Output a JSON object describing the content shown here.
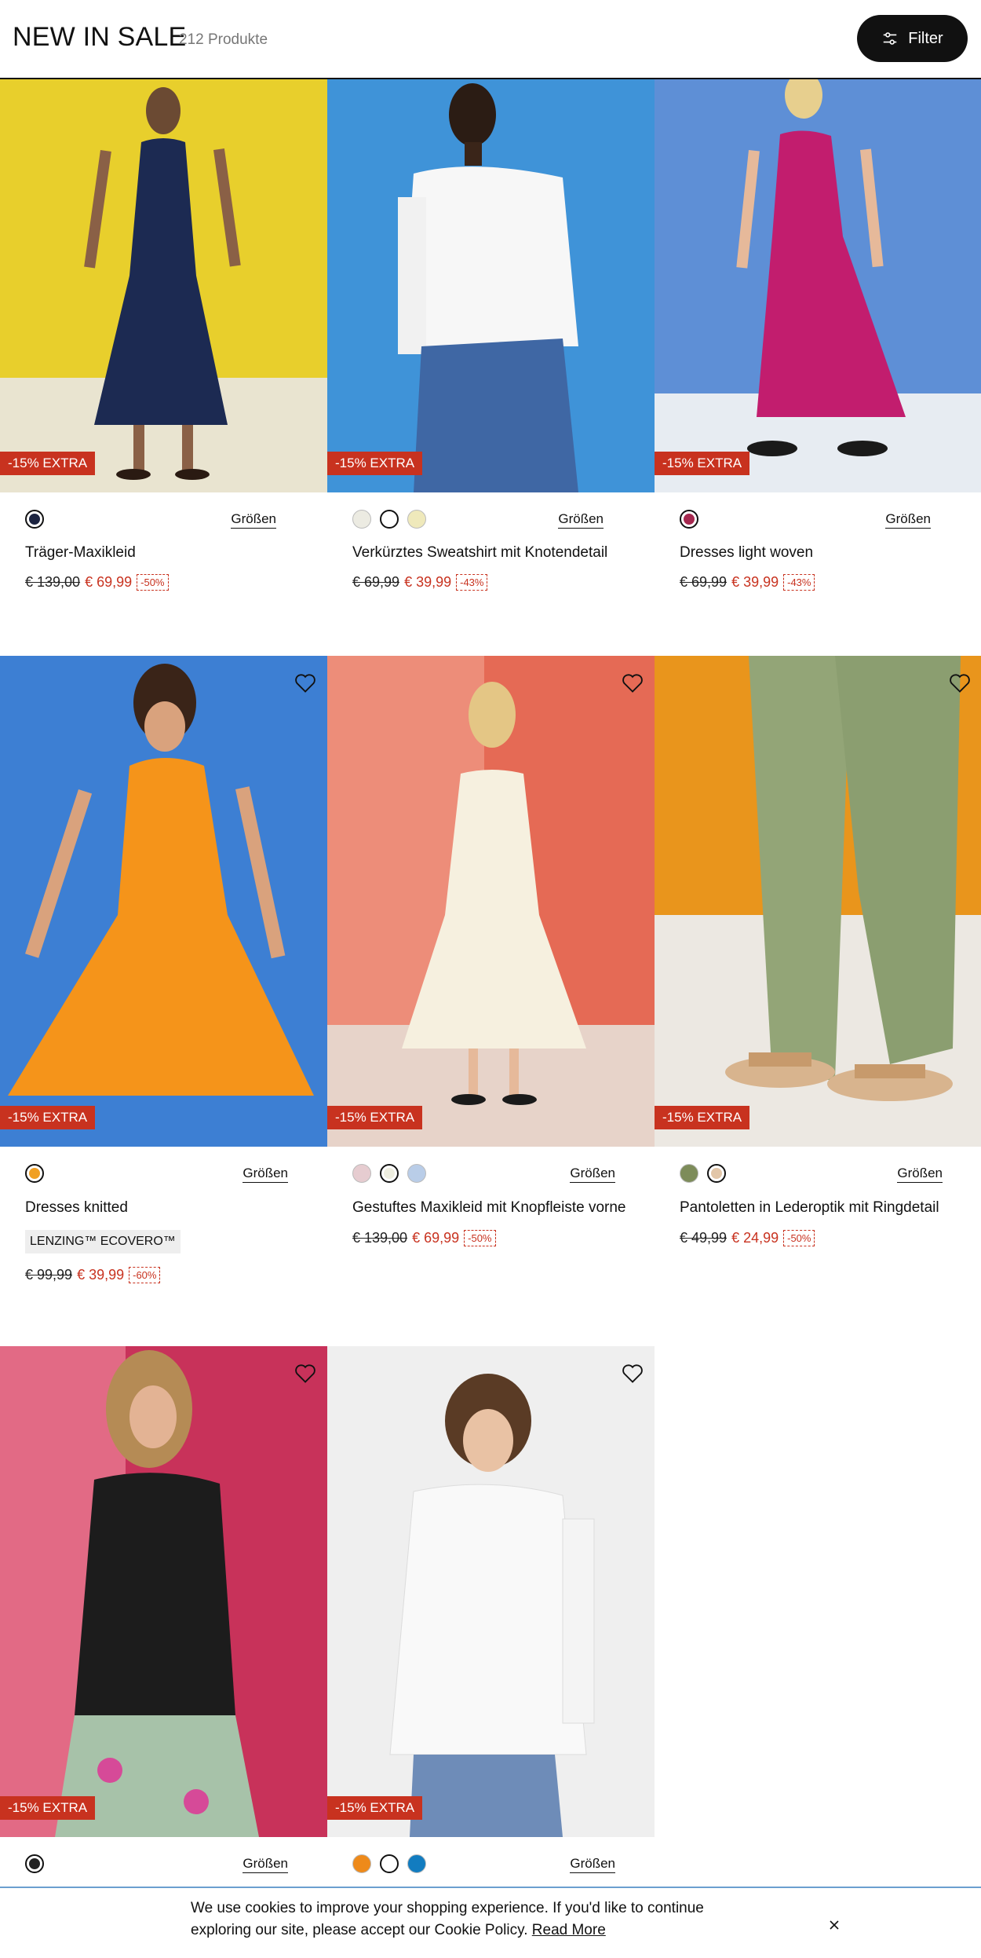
{
  "header": {
    "title": "NEW IN SALE",
    "count": "212 Produkte",
    "filter_label": "Filter"
  },
  "colors": {
    "sale_red": "#c8321f",
    "accent_dark": "#111111"
  },
  "products": [
    {
      "badge": "-15% EXTRA",
      "sizes_label": "Größen",
      "name": "Träger-Maxikleid",
      "old_price": "€ 139,00",
      "new_price": "€ 69,99",
      "discount": "-50%",
      "swatches": [
        "#1b2340"
      ],
      "selected": 0,
      "heart": false
    },
    {
      "badge": "-15% EXTRA",
      "sizes_label": "Größen",
      "name": "Verkürztes Sweatshirt mit Knotendetail",
      "old_price": "€ 69,99",
      "new_price": "€ 39,99",
      "discount": "-43%",
      "swatches": [
        "#ecebe2",
        "#ffffff",
        "#efe9bb"
      ],
      "selected": 1,
      "heart": false
    },
    {
      "badge": "-15% EXTRA",
      "sizes_label": "Größen",
      "name": "Dresses light woven",
      "old_price": "€ 69,99",
      "new_price": "€ 39,99",
      "discount": "-43%",
      "swatches": [
        "#a5284f"
      ],
      "selected": 0,
      "heart": false
    },
    {
      "badge": "-15% EXTRA",
      "sizes_label": "Größen",
      "name": "Dresses knitted",
      "tag": "LENZING™ ECOVERO™",
      "old_price": "€ 99,99",
      "new_price": "€ 39,99",
      "discount": "-60%",
      "swatches": [
        "#f0a024"
      ],
      "selected": 0,
      "heart": true
    },
    {
      "badge": "-15% EXTRA",
      "sizes_label": "Größen",
      "name": "Gestuftes Maxikleid mit Knopfleiste vorne",
      "old_price": "€ 139,00",
      "new_price": "€ 69,99",
      "discount": "-50%",
      "swatches": [
        "#e6ccd0",
        "#eeeee0",
        "#b9cde8"
      ],
      "selected": 1,
      "heart": true
    },
    {
      "badge": "-15% EXTRA",
      "sizes_label": "Größen",
      "name": "Pantoletten in Lederoptik mit Ringdetail",
      "old_price": "€ 49,99",
      "new_price": "€ 24,99",
      "discount": "-50%",
      "swatches": [
        "#7d8c5a",
        "#e2c6a8"
      ],
      "selected": 1,
      "heart": true
    },
    {
      "badge": "-15% EXTRA",
      "sizes_label": "Größen",
      "swatches": [
        "#222222"
      ],
      "selected": 0,
      "heart": true
    },
    {
      "badge": "-15% EXTRA",
      "sizes_label": "Größen",
      "swatches": [
        "#ee8a1a",
        "#ffffff",
        "#127cc0"
      ],
      "selected": 1,
      "heart": true
    }
  ],
  "cookie": {
    "message": "We use cookies to improve your shopping experience. If you'd like to continue exploring our site, please accept our Cookie Policy.",
    "link": "Read More"
  }
}
